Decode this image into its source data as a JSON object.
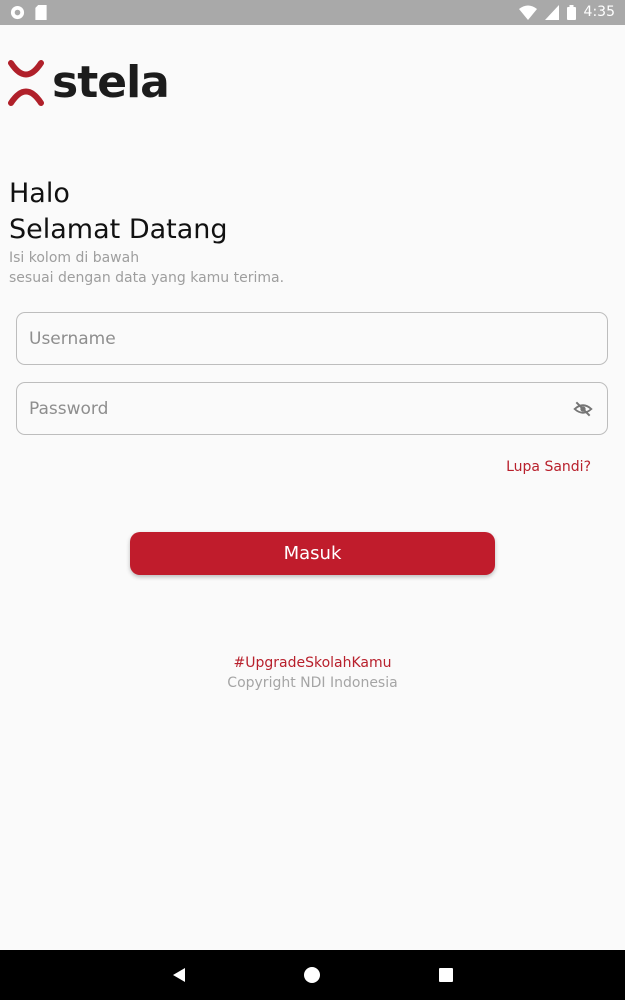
{
  "status_bar": {
    "time": "4:35",
    "icons": [
      "notification-circle-icon",
      "sd-card-icon",
      "wifi-icon",
      "signal-icon",
      "battery-icon"
    ]
  },
  "brand": {
    "name": "stela",
    "accent_color": "#c01c2c"
  },
  "greeting": {
    "line1": "Halo",
    "line2": "Selamat Datang",
    "subtitle_line1": "Isi kolom di bawah",
    "subtitle_line2": "sesuai dengan data yang kamu terima."
  },
  "form": {
    "username": {
      "value": "",
      "placeholder": "Username"
    },
    "password": {
      "value": "",
      "placeholder": "Password",
      "visibility_icon": "eye-off-icon"
    },
    "forgot_label": "Lupa Sandi?",
    "submit_label": "Masuk"
  },
  "footer": {
    "hashtag": "#UpgradeSkolahKamu",
    "copyright": "Copyright NDI Indonesia"
  },
  "nav_bar": {
    "buttons": [
      "back-icon",
      "home-icon",
      "recents-icon"
    ]
  }
}
